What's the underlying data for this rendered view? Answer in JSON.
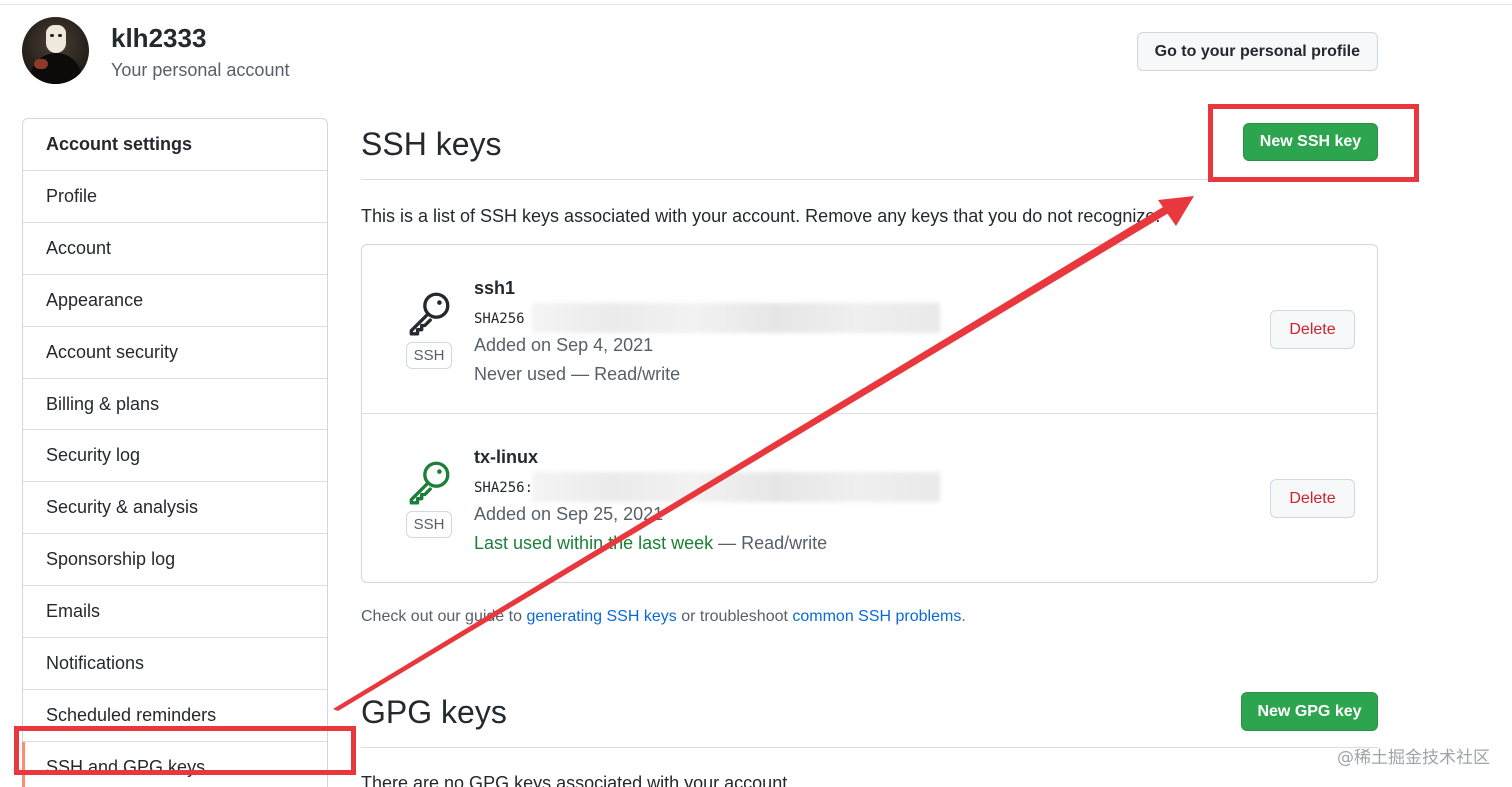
{
  "header": {
    "username": "klh2333",
    "subtitle": "Your personal account",
    "profile_button": "Go to your personal profile"
  },
  "sidebar": {
    "heading": "Account settings",
    "items": [
      {
        "label": "Profile"
      },
      {
        "label": "Account"
      },
      {
        "label": "Appearance"
      },
      {
        "label": "Account security"
      },
      {
        "label": "Billing & plans"
      },
      {
        "label": "Security log"
      },
      {
        "label": "Security & analysis"
      },
      {
        "label": "Sponsorship log"
      },
      {
        "label": "Emails"
      },
      {
        "label": "Notifications"
      },
      {
        "label": "Scheduled reminders"
      },
      {
        "label": "SSH and GPG keys",
        "active": true
      }
    ]
  },
  "ssh": {
    "title": "SSH keys",
    "new_button": "New SSH key",
    "intro": "This is a list of SSH keys associated with your account. Remove any keys that you do not recognize.",
    "keys": [
      {
        "name": "ssh1",
        "fingerprint_label": "SHA256",
        "added": "Added on Sep 4, 2021",
        "usage_prefix": "",
        "usage_main": "Never used",
        "usage_suffix": " — Read/write",
        "badge": "SSH",
        "delete_label": "Delete",
        "icon": "key-icon",
        "icon_color": "#24292f"
      },
      {
        "name": "tx-linux",
        "fingerprint_label": "SHA256:",
        "added": "Added on Sep 25, 2021",
        "usage_main": "Last used within the last week",
        "usage_suffix": " — Read/write",
        "badge": "SSH",
        "delete_label": "Delete",
        "icon": "key-icon",
        "icon_color": "#1a7f37"
      }
    ],
    "guide": {
      "prefix": "Check out our guide to ",
      "link1": "generating SSH keys",
      "middle": " or troubleshoot ",
      "link2": "common SSH problems",
      "suffix": "."
    }
  },
  "gpg": {
    "title": "GPG keys",
    "new_button": "New GPG key",
    "empty_text": "There are no GPG keys associated with your account."
  },
  "watermark": "@稀土掘金技术社区",
  "colors": {
    "primary_green": "#2da44e",
    "danger_red": "#cf222e",
    "link_blue": "#0969da",
    "annotation_red": "#e8383d"
  }
}
